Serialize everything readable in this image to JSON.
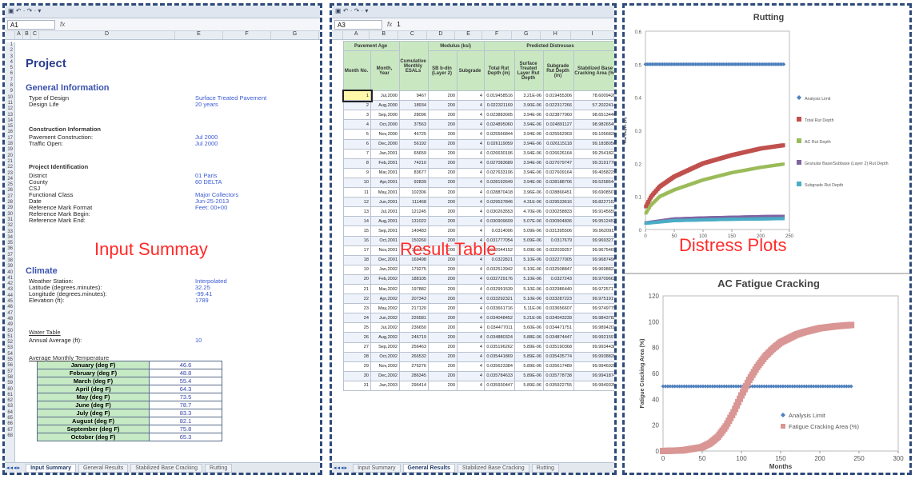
{
  "panel_input": {
    "namebox": "A1",
    "fx": "fx",
    "project_title": "Project",
    "general_heading": "General Information",
    "general": [
      {
        "k": "Type of Design",
        "v": "Surface Treated Pavement"
      },
      {
        "k": "Design Life",
        "v": "20 years"
      }
    ],
    "construction_heading": "Construction Information",
    "construction": [
      {
        "k": "Pavement Construction:",
        "v": "Jul 2000"
      },
      {
        "k": "Traffic Open:",
        "v": "Jul 2000"
      }
    ],
    "project_id_heading": "Project Identification",
    "project_id": [
      {
        "k": "District",
        "v": "01 Paris"
      },
      {
        "k": "County",
        "v": "60 DELTA"
      },
      {
        "k": "CSJ",
        "v": ""
      },
      {
        "k": "Functional Class",
        "v": "Major Collectors"
      },
      {
        "k": "Date",
        "v": "Jun-25-2013"
      },
      {
        "k": "Reference Mark Format",
        "v": "Feet: 00+00"
      },
      {
        "k": "Reference Mark Begin:",
        "v": ""
      },
      {
        "k": "Reference Mark End:",
        "v": ""
      }
    ],
    "climate_heading": "Climate",
    "climate": [
      {
        "k": "Weather Station:",
        "v": "Interpolated"
      },
      {
        "k": "Latitude (degrees.minutes):",
        "v": "32.25"
      },
      {
        "k": "Longitude (degrees.minutes):",
        "v": "-99.41"
      },
      {
        "k": "Elevation (ft):",
        "v": "1789"
      }
    ],
    "water_table_heading": "Water Table",
    "water_table": [
      {
        "k": "Annual Average (ft):",
        "v": "10"
      }
    ],
    "temp_heading": "Average Monthly Temperature",
    "temps": [
      {
        "m": "January (deg F)",
        "t": "46.6"
      },
      {
        "m": "February (deg F)",
        "t": "48.8"
      },
      {
        "m": "March (deg F)",
        "t": "55.4"
      },
      {
        "m": "April (deg F)",
        "t": "64.3"
      },
      {
        "m": "May (deg F)",
        "t": "73.5"
      },
      {
        "m": "June (deg F)",
        "t": "78.7"
      },
      {
        "m": "July (deg F)",
        "t": "83.3"
      },
      {
        "m": "August (deg F)",
        "t": "82.1"
      },
      {
        "m": "September (deg F)",
        "t": "75.8"
      },
      {
        "m": "October (deg F)",
        "t": "65.3"
      }
    ],
    "tabs": [
      "Input Summary",
      "General Results",
      "Stabilized Base Cracking",
      "Rutting"
    ],
    "overlay": "Input Summay"
  },
  "panel_result": {
    "namebox": "A3",
    "fx": "fx",
    "formula": "1",
    "columns": [
      "A",
      "B",
      "C",
      "D",
      "E",
      "F",
      "G",
      "H",
      "I"
    ],
    "group_headers": {
      "age": "Pavement Age",
      "modulus": "Modulus (ksi)",
      "distress": "Predicted Distresses"
    },
    "sub_headers": [
      "Month No.",
      "Month, Year",
      "Cumulative Monthly ESALs",
      "SB b-din (Layer 2)",
      "Subgrade",
      "Total Rut Depth (in)",
      "Surface Treated Layer Rut Depth",
      "Subgrade Rut Depth (in)",
      "Stabilized Base Cracking Area (%)"
    ],
    "rows": [
      [
        "1",
        "Jul,2000",
        "9467",
        "200",
        "4",
        "0.019458516",
        "3.21E-06",
        "0.019455306",
        "78.6009420"
      ],
      [
        "2",
        "Aug,2000",
        "18934",
        "200",
        "4",
        "0.022321169",
        "3.90E-06",
        "0.022317266",
        "57.2022414"
      ],
      [
        "3",
        "Sep,2000",
        "28096",
        "200",
        "4",
        "0.023883005",
        "3.94E-06",
        "0.023877060",
        "98.6513446"
      ],
      [
        "4",
        "Oct,2000",
        "37563",
        "200",
        "4",
        "0.024895060",
        "3.94E-06",
        "0.024891127",
        "98.9826549"
      ],
      [
        "5",
        "Nov,2000",
        "46725",
        "200",
        "4",
        "0.025566844",
        "3.94E-06",
        "0.025562903",
        "99.1056820"
      ],
      [
        "6",
        "Dec,2000",
        "56192",
        "200",
        "4",
        "0.026119059",
        "3.94E-06",
        "0.026115118",
        "99.1838056"
      ],
      [
        "7",
        "Jan,2001",
        "65659",
        "200",
        "4",
        "0.026630106",
        "3.94E-06",
        "0.026626164",
        "99.2541822"
      ],
      [
        "8",
        "Feb,2001",
        "74210",
        "200",
        "4",
        "0.027083689",
        "3.94E-06",
        "0.027079747",
        "99.3191770"
      ],
      [
        "9",
        "Mar,2001",
        "83677",
        "200",
        "4",
        "0.027633106",
        "3.94E-06",
        "0.027609164",
        "99.4058229"
      ],
      [
        "10",
        "Apr,2001",
        "92839",
        "200",
        "4",
        "0.028192649",
        "3.94E-06",
        "0.028188706",
        "99.5258544"
      ],
      [
        "11",
        "May,2001",
        "102306",
        "200",
        "4",
        "0.028870418",
        "3.96E-06",
        "0.028866451",
        "99.6908507"
      ],
      [
        "12",
        "Jun,2001",
        "111468",
        "200",
        "4",
        "0.029537846",
        "4.31E-06",
        "0.029533616",
        "99.8227152"
      ],
      [
        "13",
        "Jul,2001",
        "121245",
        "200",
        "4",
        "0.030263553",
        "4.70E-06",
        "0.030258833",
        "99.9145659"
      ],
      [
        "14",
        "Aug,2001",
        "131022",
        "200",
        "4",
        "0.030909609",
        "5.07E-06",
        "0.030904836",
        "99.9512453"
      ],
      [
        "15",
        "Sep,2001",
        "140483",
        "200",
        "4",
        "0.0314006",
        "5.09E-06",
        "0.031395506",
        "99.9620911"
      ],
      [
        "16",
        "Oct,2001",
        "150260",
        "200",
        "4",
        "0.031777054",
        "5.09E-06",
        "0.0317679",
        "99.9693271"
      ],
      [
        "17",
        "Nov,2001",
        "159721",
        "200",
        "4",
        "0.032044152",
        "5.09E-06",
        "0.032039257",
        "99.9675469"
      ],
      [
        "18",
        "Dec,2001",
        "169498",
        "200",
        "4",
        "0.0322821",
        "5.10E-06",
        "0.032277005",
        "99.9687496"
      ],
      [
        "19",
        "Jan,2002",
        "179275",
        "200",
        "4",
        "0.032513942",
        "5.10E-06",
        "0.032508847",
        "99.9698822"
      ],
      [
        "20",
        "Feb,2002",
        "188105",
        "200",
        "4",
        "0.032729176",
        "5.10E-06",
        "0.0327243",
        "99.9709662"
      ],
      [
        "21",
        "Mar,2002",
        "197882",
        "200",
        "4",
        "0.032991539",
        "5.10E-06",
        "0.032986440",
        "99.9725717"
      ],
      [
        "22",
        "Apr,2002",
        "207343",
        "200",
        "4",
        "0.033292321",
        "5.10E-06",
        "0.033287223",
        "99.9751917"
      ],
      [
        "23",
        "May,2002",
        "217120",
        "200",
        "4",
        "0.033661716",
        "5.11E-06",
        "0.033656607",
        "99.9749779"
      ],
      [
        "24",
        "Jun,2002",
        "226581",
        "200",
        "4",
        "0.034048452",
        "5.21E-06",
        "0.034043239",
        "99.9843782"
      ],
      [
        "25",
        "Jul,2002",
        "236650",
        "200",
        "4",
        "0.034477011",
        "5.60E-06",
        "0.034471751",
        "99.9894202"
      ],
      [
        "26",
        "Aug,2002",
        "246719",
        "200",
        "4",
        "0.034880324",
        "5.88E-06",
        "0.034874447",
        "99.9921597"
      ],
      [
        "27",
        "Sep,2002",
        "256463",
        "200",
        "4",
        "0.035196262",
        "5.89E-06",
        "0.035190368",
        "99.9934438"
      ],
      [
        "28",
        "Oct,2002",
        "266532",
        "200",
        "4",
        "0.035441869",
        "5.89E-06",
        "0.035435774",
        "99.9938828"
      ],
      [
        "29",
        "Nov,2002",
        "276276",
        "200",
        "4",
        "0.035623384",
        "5.89E-06",
        "0.035617489",
        "99.9946926"
      ],
      [
        "30",
        "Dec,2002",
        "286345",
        "200",
        "4",
        "0.035784633",
        "5.89E-06",
        "0.035778738",
        "99.9941874"
      ],
      [
        "31",
        "Jan,2003",
        "296414",
        "200",
        "4",
        "0.035930447",
        "5.89E-06",
        "0.035922755",
        "99.9949335"
      ]
    ],
    "tabs": [
      "Input Summary",
      "General Results",
      "Stabilized Base Cracking",
      "Rutting"
    ],
    "overlay": "Result Table"
  },
  "panel_plots": {
    "overlay": "Distress Plots",
    "colors": {
      "limit": "#4f81bd",
      "total": "#c0504d",
      "ac": "#9bbb59",
      "granular": "#8064a2",
      "subgrade": "#4bacc6",
      "fatigue": "#d99694"
    },
    "rutting": {
      "title": "Rutting",
      "ylabel": "Rut Depth (in)",
      "yticks": [
        "0.6",
        "0.5",
        "0.4",
        "0.3",
        "0.2",
        "0.1",
        "0"
      ],
      "xticks": [
        "0",
        "50",
        "100",
        "150",
        "200",
        "250"
      ],
      "legend": [
        "Analysis Limit",
        "Total Rut Depth",
        "AC Rut Depth",
        "Granular Base/Subbase (Layer 2) Rut Depth",
        "Subgrade Rut Depth"
      ]
    },
    "fatigue": {
      "title": "AC Fatigue Cracking",
      "ylabel": "Fatigue Cracking Area (%)",
      "xlabel": "Months",
      "yticks": [
        "120",
        "100",
        "80",
        "60",
        "40",
        "20",
        "0"
      ],
      "xticks": [
        "0",
        "50",
        "100",
        "150",
        "200",
        "250",
        "300"
      ],
      "legend": [
        "Analysis Limit",
        "Fatigue Cracking Area (%)"
      ]
    }
  },
  "chart_data": [
    {
      "type": "scatter",
      "title": "Rutting",
      "xlabel": "",
      "ylabel": "Rut Depth (in)",
      "xlim": [
        0,
        250
      ],
      "ylim": [
        0,
        0.6
      ],
      "series": [
        {
          "name": "Analysis Limit",
          "x": [
            0,
            240
          ],
          "y": [
            0.5,
            0.5
          ]
        },
        {
          "name": "Total Rut Depth",
          "x": [
            1,
            10,
            25,
            50,
            100,
            150,
            200,
            240
          ],
          "y": [
            0.07,
            0.1,
            0.13,
            0.16,
            0.2,
            0.225,
            0.245,
            0.255
          ]
        },
        {
          "name": "AC Rut Depth",
          "x": [
            1,
            10,
            25,
            50,
            100,
            150,
            200,
            240
          ],
          "y": [
            0.05,
            0.075,
            0.1,
            0.12,
            0.15,
            0.172,
            0.188,
            0.198
          ]
        },
        {
          "name": "Granular Base/Subbase (Layer 2) Rut Depth",
          "x": [
            1,
            50,
            100,
            150,
            200,
            240
          ],
          "y": [
            0.02,
            0.032,
            0.035,
            0.037,
            0.039,
            0.04
          ]
        },
        {
          "name": "Subgrade Rut Depth",
          "x": [
            1,
            50,
            100,
            150,
            200,
            240
          ],
          "y": [
            0.019,
            0.027,
            0.029,
            0.031,
            0.032,
            0.033
          ]
        }
      ]
    },
    {
      "type": "scatter",
      "title": "AC Fatigue Cracking",
      "xlabel": "Months",
      "ylabel": "Fatigue Cracking Area (%)",
      "xlim": [
        0,
        300
      ],
      "ylim": [
        0,
        120
      ],
      "series": [
        {
          "name": "Analysis Limit",
          "x": [
            0,
            240
          ],
          "y": [
            50,
            50
          ]
        },
        {
          "name": "Fatigue Cracking Area (%)",
          "x": [
            0,
            25,
            50,
            60,
            70,
            80,
            90,
            100,
            110,
            120,
            130,
            140,
            150,
            160,
            170,
            180,
            200,
            220,
            240
          ],
          "y": [
            0,
            0.5,
            3,
            6,
            11,
            19,
            30,
            43,
            55,
            65,
            73,
            79,
            84,
            87,
            90,
            92,
            95,
            96.5,
            97.5
          ]
        }
      ]
    }
  ]
}
